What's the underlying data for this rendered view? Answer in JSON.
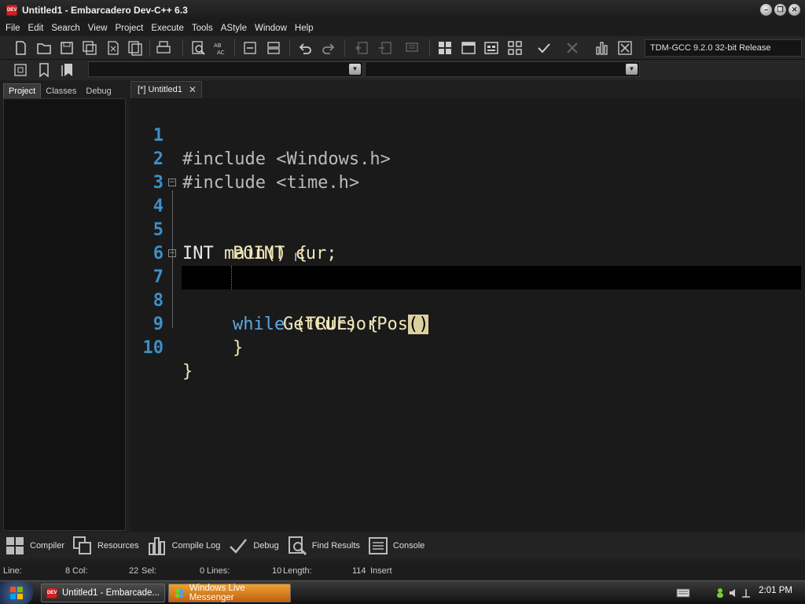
{
  "window": {
    "title": "Untitled1 - Embarcadero Dev-C++ 6.3",
    "app_icon_text": "DEV",
    "controls": [
      "minimize",
      "restore",
      "close"
    ]
  },
  "menu": [
    "File",
    "Edit",
    "Search",
    "View",
    "Project",
    "Execute",
    "Tools",
    "AStyle",
    "Window",
    "Help"
  ],
  "toolbar": {
    "compiler": "TDM-GCC 9.2.0 32-bit Release"
  },
  "left_tabs": [
    "Project",
    "Classes",
    "Debug"
  ],
  "editor_tab": {
    "label": "[*] Untitled1",
    "close": "✕"
  },
  "code": {
    "line_numbers": [
      "1",
      "2",
      "3",
      "4",
      "5",
      "6",
      "7",
      "8",
      "9",
      "10"
    ],
    "l1": "#include <Windows.h>",
    "l2": "#include <time.h>",
    "l4_type": "INT",
    "l4_fn": " main",
    "l4_rest": "() {",
    "l5_type": "POINT",
    "l5_rest": " cur;",
    "l7_kw": "while",
    "l7_rest": " (TRUE) {",
    "l8_fn": "GetCursorPos",
    "l8_paren": "()",
    "l9": "}",
    "l10": "}",
    "fold_symbol": "−"
  },
  "bottom_tabs": [
    {
      "icon": "compiler-icon",
      "label": "Compiler"
    },
    {
      "icon": "resources-icon",
      "label": "Resources"
    },
    {
      "icon": "compile-log-icon",
      "label": "Compile Log"
    },
    {
      "icon": "debug-check-icon",
      "label": "Debug"
    },
    {
      "icon": "find-results-icon",
      "label": "Find Results"
    },
    {
      "icon": "console-icon",
      "label": "Console"
    }
  ],
  "status": {
    "line_label": "Line:",
    "line_value": "8",
    "col_label": "Col:",
    "col_value": "22",
    "sel_label": "Sel:",
    "sel_value": "0",
    "lines_label": "Lines:",
    "lines_value": "10",
    "length_label": "Length:",
    "length_value": "114",
    "mode": "Insert"
  },
  "taskbar": {
    "task1": "Untitled1 - Embarcade...",
    "task2": "Windows Live Messenger",
    "clock": "2:01 PM"
  },
  "colors": {
    "line_number": "#3e8fc8",
    "keyword": "#5fa8e0",
    "identifier": "#f0e6b8",
    "bracket_highlight": "#ddd0a0",
    "current_line": "#000000"
  }
}
